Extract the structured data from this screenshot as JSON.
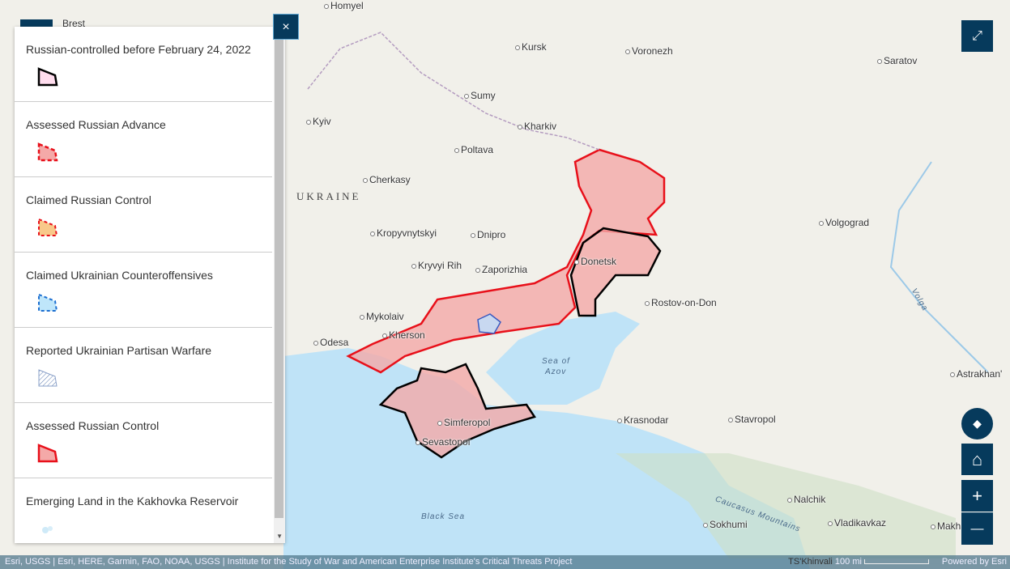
{
  "legend": {
    "items": [
      {
        "label": "Russian-controlled before February 24, 2022",
        "icon": "black-outline-hatched-swatch"
      },
      {
        "label": "Assessed Russian Advance",
        "icon": "red-dashed-swatch"
      },
      {
        "label": "Claimed Russian Control",
        "icon": "orange-dashed-swatch"
      },
      {
        "label": "Claimed Ukrainian Counteroffensives",
        "icon": "blue-dashed-swatch"
      },
      {
        "label": "Reported Ukrainian Partisan Warfare",
        "icon": "blue-hatched-swatch"
      },
      {
        "label": "Assessed Russian Control",
        "icon": "red-solid-swatch"
      },
      {
        "label": "Emerging Land in the Kakhovka Reservoir",
        "icon": "light-blue-swatch"
      }
    ],
    "close": "×"
  },
  "map": {
    "cities": [
      "Brest",
      "Homyel",
      "Kursk",
      "Voronezh",
      "Saratov",
      "Sumy",
      "Kyiv",
      "Kharkiv",
      "Poltava",
      "Cherkasy",
      "Volgograd",
      "Kropyvnytskyi",
      "Dnipro",
      "Donetsk",
      "Kryvyi Rih",
      "Zaporizhia",
      "Rostov-on-Don",
      "Mykolaiv",
      "Kherson",
      "Odesa",
      "Astrakhan'",
      "Krasnodar",
      "Stavropol",
      "Simferopol",
      "Sevastopol",
      "Nalchik",
      "Vladikavkaz",
      "Sokhumi",
      "Makha"
    ],
    "country": "UKRAINE",
    "seas": [
      "Sea of",
      "Azov",
      "Black Sea"
    ],
    "other": [
      "Caucasus Mountains",
      "Volga"
    ]
  },
  "controls": {
    "expand": "⤢",
    "compass": "◆",
    "home": "⌂",
    "zoom_in": "+",
    "zoom_out": "—"
  },
  "footer": {
    "attribution": "Esri, USGS | Esri, HERE, Garmin, FAO, NOAA, USGS | Institute for the Study of War and American Enterprise Institute's Critical Threats Project",
    "scale": "100 mi",
    "scale_city": "TS'Khinvali",
    "powered": "Powered by Esri"
  },
  "colors": {
    "panel": "#063a5c",
    "occupied_fill": "#f4a9a8",
    "occupied_stroke": "#e8101a",
    "sea": "#bfe3f7"
  }
}
